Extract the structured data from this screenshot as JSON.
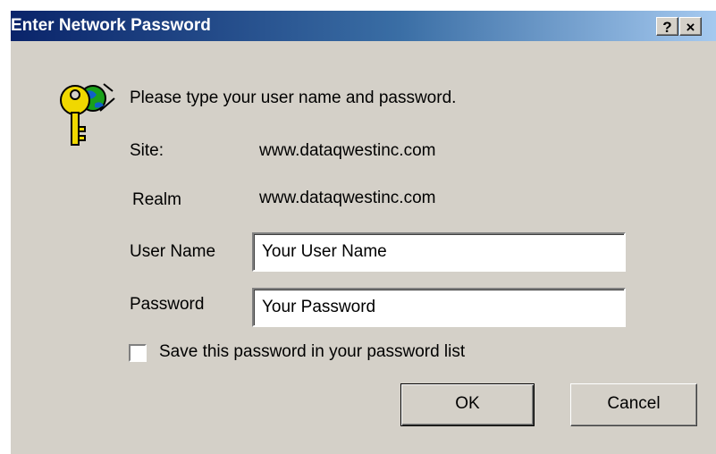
{
  "window": {
    "title": "Enter Network Password",
    "help_label": "?",
    "close_label": "×"
  },
  "dialog": {
    "prompt": "Please type your user name and password.",
    "site_label": "Site:",
    "site_value": "www.dataqwestinc.com",
    "realm_label": "Realm",
    "realm_value": "www.dataqwestinc.com",
    "user_label": "User Name",
    "user_value": "Your User Name",
    "password_label": "Password",
    "password_value": "Your Password",
    "save_password_label": "Save this password in your password list",
    "save_password_checked": false,
    "ok_label": "OK",
    "cancel_label": "Cancel"
  },
  "icon": {
    "name": "keys-icon",
    "key_color": "#f0d800",
    "globe_color": "#1aa01a"
  },
  "colors": {
    "dialog_bg": "#d4d0c8",
    "title_start": "#0a246a",
    "title_end": "#a6caf0"
  }
}
